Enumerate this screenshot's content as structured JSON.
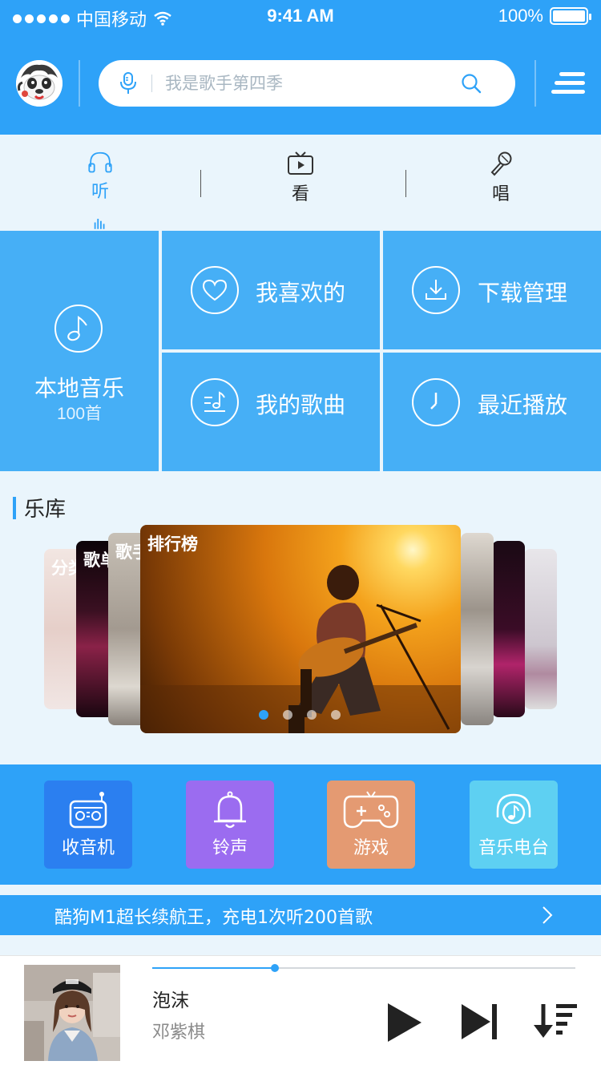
{
  "status_bar": {
    "carrier": "中国移动",
    "time": "9:41 AM",
    "battery": "100%"
  },
  "search": {
    "placeholder": "我是歌手第四季"
  },
  "tabs": [
    {
      "label": "听",
      "active": true
    },
    {
      "label": "看",
      "active": false
    },
    {
      "label": "唱",
      "active": false
    }
  ],
  "grid": {
    "local": {
      "label": "本地音乐",
      "count": "100首"
    },
    "favorites": {
      "label": "我喜欢的"
    },
    "downloads": {
      "label": "下载管理"
    },
    "my_songs": {
      "label": "我的歌曲"
    },
    "recent": {
      "label": "最近播放"
    }
  },
  "library": {
    "title": "乐库",
    "cards": [
      "分类",
      "歌单",
      "歌手",
      "排行榜"
    ],
    "active_page": 1,
    "page_count": 4
  },
  "quick": [
    {
      "label": "收音机",
      "icon": "radio-icon",
      "color": "#2b7ff0"
    },
    {
      "label": "铃声",
      "icon": "bell-icon",
      "color": "#9b6cf0"
    },
    {
      "label": "游戏",
      "icon": "gamepad-icon",
      "color": "#e49a72"
    },
    {
      "label": "音乐电台",
      "icon": "headphone-note-icon",
      "color": "#5ed0f2"
    }
  ],
  "banner": {
    "text": "酷狗M1超长续航王，充电1次听200首歌"
  },
  "player": {
    "title": "泡沫",
    "artist": "邓紫棋",
    "progress": 0.29
  },
  "colors": {
    "primary": "#2ea2f8",
    "tile": "#46aff6",
    "background": "#eaf5fc"
  }
}
